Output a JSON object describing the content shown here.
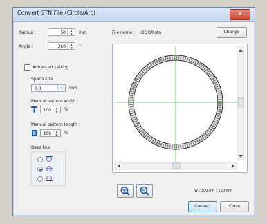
{
  "dialog": {
    "title": "Convert STN File (Circle/Arc)",
    "close_label": "✕"
  },
  "left": {
    "radius_label": "Radius :",
    "radius_value": "50",
    "radius_unit": "mm",
    "angle_label": "Angle :",
    "angle_value": "360",
    "angle_unit": "°",
    "advanced_label": "Advanced setting",
    "space_size_label": "Space size :",
    "space_size_value": "0.0",
    "space_size_unit": "mm",
    "pattern_width_label": "Manual pattern width :",
    "pattern_width_value": "100",
    "pattern_width_unit": "%",
    "pattern_length_label": "Manual pattern length :",
    "pattern_length_value": "100",
    "pattern_length_unit": "%",
    "base_line_label": "Base line"
  },
  "right": {
    "file_name_label": "File name :",
    "file_name_value": "DOOR.stn",
    "change_button": "Change",
    "size_readout": "W : 300.4 H : 100 mm",
    "convert_button": "Convert",
    "close_button": "Close"
  },
  "icons": {
    "zoom_in": "zoom-in-icon",
    "zoom_out": "zoom-out-icon"
  },
  "colors": {
    "ring": "#3a3a3a",
    "guide": "#40c040",
    "title_bar": "#c6d8ee"
  }
}
